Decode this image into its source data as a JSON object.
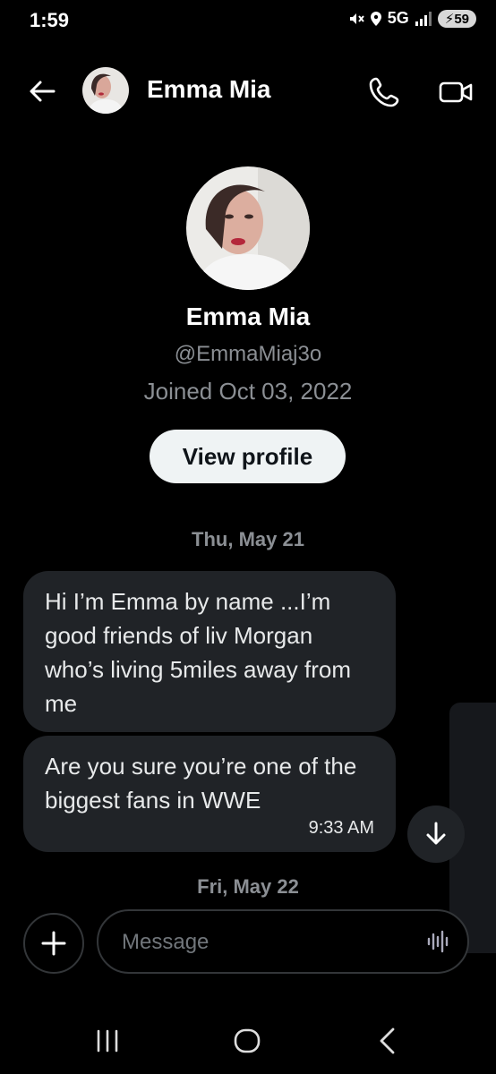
{
  "status_bar": {
    "time": "1:59",
    "network": "5G",
    "battery": "59",
    "icons": [
      "mute-icon",
      "location-icon",
      "signal-icon",
      "battery-icon"
    ]
  },
  "header": {
    "contact_name": "Emma Mia",
    "icons": [
      "back-arrow-icon",
      "avatar",
      "phone-icon",
      "video-camera-icon"
    ]
  },
  "profile": {
    "name": "Emma Mia",
    "handle": "@EmmaMiaj3o",
    "joined": "Joined Oct 03, 2022",
    "view_profile_label": "View profile"
  },
  "conversation": {
    "date_1": "Thu, May 21",
    "messages": [
      {
        "text": "Hi I’m Emma by name ...I’m good friends of liv Morgan who’s living 5miles away from me"
      },
      {
        "text": "Are you sure you’re one of the biggest fans in WWE",
        "time": "9:33 AM"
      }
    ],
    "date_2": "Fri, May 22"
  },
  "composer": {
    "placeholder": "Message"
  },
  "colors": {
    "background": "#000000",
    "bubble": "#202327",
    "muted_text": "#8b8f94",
    "button_bg": "#eff3f4"
  }
}
